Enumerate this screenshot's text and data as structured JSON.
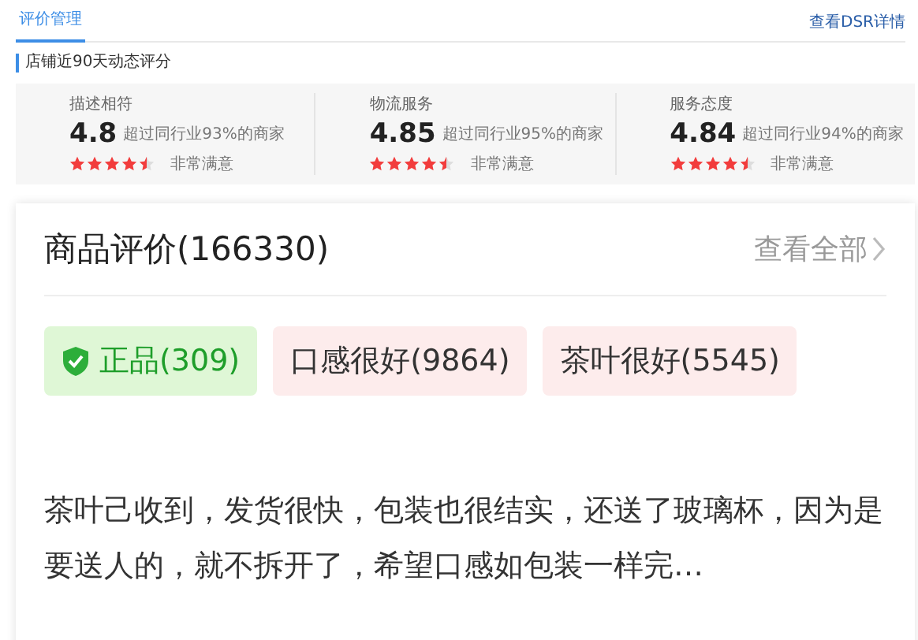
{
  "tabs": [
    {
      "label": "评价管理",
      "selected": true
    }
  ],
  "dsr_link": "查看DSR详情",
  "section_title": "店铺近90天动态评分",
  "scores": [
    {
      "name": "描述相符",
      "score": "4.8",
      "compare": "超过同行业93%的商家",
      "stars": 4.5,
      "verdict": "非常满意"
    },
    {
      "name": "物流服务",
      "score": "4.85",
      "compare": "超过同行业95%的商家",
      "stars": 4.5,
      "verdict": "非常满意"
    },
    {
      "name": "服务态度",
      "score": "4.84",
      "compare": "超过同行业94%的商家",
      "stars": 4.5,
      "verdict": "非常满意"
    }
  ],
  "reviews": {
    "title": "商品评价(166330)",
    "view_all": "查看全部",
    "tags": [
      {
        "label": "正品(309)",
        "kind": "verified"
      },
      {
        "label": "口感很好(9864)",
        "kind": "normal"
      },
      {
        "label": "茶叶很好(5545)",
        "kind": "normal"
      }
    ],
    "text": "茶叶己收到，发货很快，包装也很结实，还送了玻璃杯，因为是要送人的，就不拆开了，希望口感如包装一样完…"
  }
}
